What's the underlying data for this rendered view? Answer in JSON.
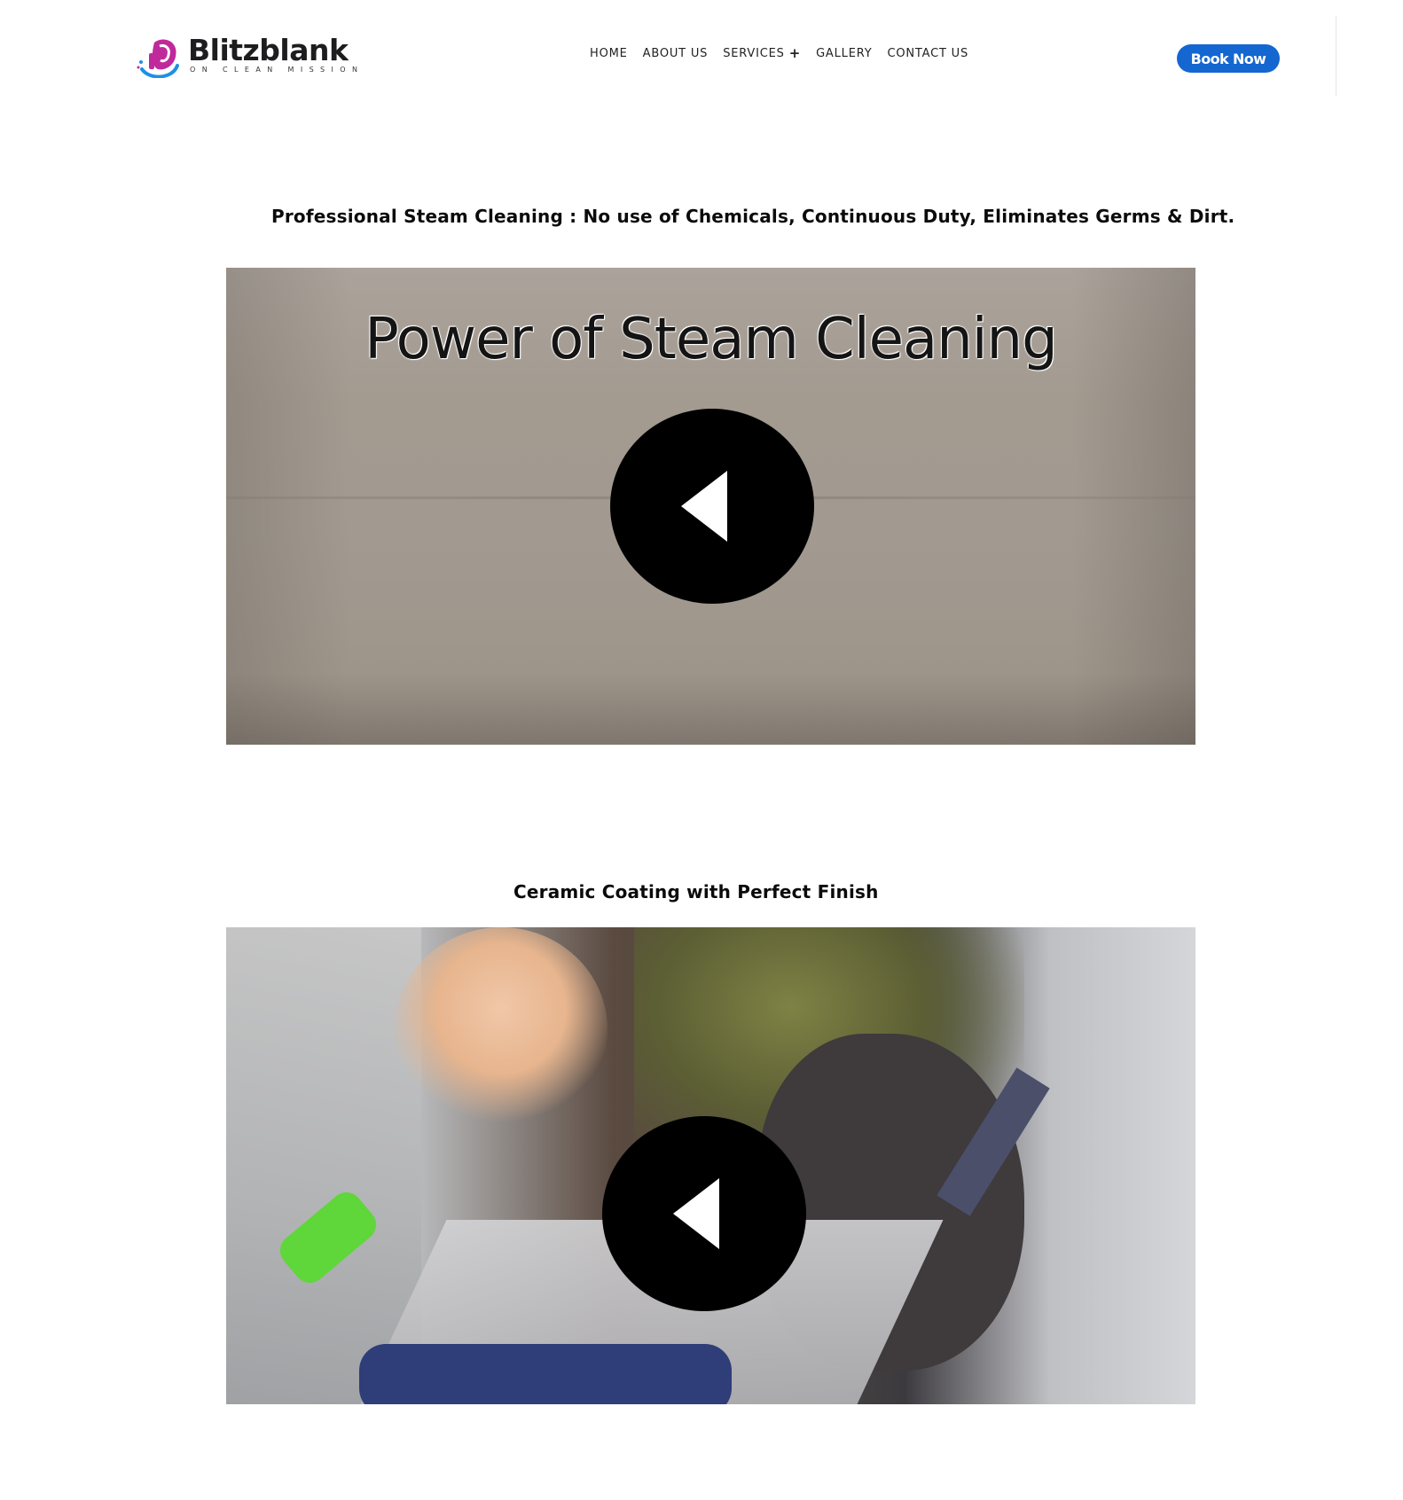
{
  "header": {
    "logo": {
      "name": "Blitzblank",
      "tagline": "ON CLEAN MISSION"
    },
    "nav": [
      {
        "label": "HOME"
      },
      {
        "label": "ABOUT US"
      },
      {
        "label": "SERVICES",
        "has_submenu": true,
        "submenu_glyph": "+"
      },
      {
        "label": "GALLERY"
      },
      {
        "label": "CONTACT US"
      }
    ],
    "cta": {
      "label": "Book Now",
      "color": "#1466d0"
    }
  },
  "sections": [
    {
      "title": "Professional Steam Cleaning : No use of Chemicals, Continuous Duty, Eliminates Germs & Dirt.",
      "video": {
        "overlay_text": "Power of Steam Cleaning",
        "play_icon": "play-icon"
      }
    },
    {
      "title": "Ceramic Coating with Perfect Finish",
      "video": {
        "overlay_text": "",
        "play_icon": "play-icon"
      }
    }
  ],
  "colors": {
    "accent": "#1466d0",
    "logo_pink": "#c0299b",
    "logo_blue": "#1f8fe6"
  }
}
